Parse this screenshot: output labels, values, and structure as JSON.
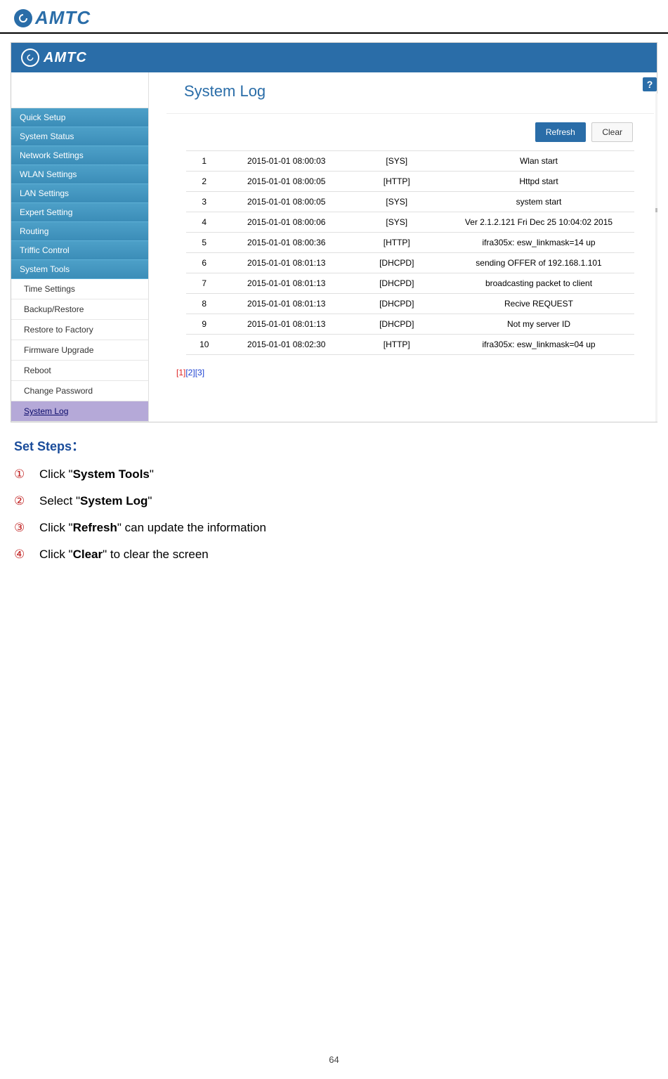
{
  "doc_logo_text": "AMTC",
  "app_logo_text": "AMTC",
  "page_title": "System Log",
  "help_label": "?",
  "buttons": {
    "refresh": "Refresh",
    "clear": "Clear"
  },
  "sidebar": {
    "main": [
      "Quick Setup",
      "System Status",
      "Network Settings",
      "WLAN Settings",
      "LAN Settings",
      "Expert Setting",
      "Routing",
      "Triffic Control",
      "System Tools"
    ],
    "sub": [
      "Time Settings",
      "Backup/Restore",
      "Restore to Factory",
      "Firmware Upgrade",
      "Reboot",
      "Change Password",
      "System Log"
    ],
    "active_sub_index": 6
  },
  "log_rows": [
    {
      "idx": "1",
      "ts": "2015-01-01 08:00:03",
      "mod": "[SYS]",
      "msg": "Wlan start"
    },
    {
      "idx": "2",
      "ts": "2015-01-01 08:00:05",
      "mod": "[HTTP]",
      "msg": "Httpd start"
    },
    {
      "idx": "3",
      "ts": "2015-01-01 08:00:05",
      "mod": "[SYS]",
      "msg": "system start"
    },
    {
      "idx": "4",
      "ts": "2015-01-01 08:00:06",
      "mod": "[SYS]",
      "msg": "Ver 2.1.2.121 Fri Dec 25 10:04:02 2015"
    },
    {
      "idx": "5",
      "ts": "2015-01-01 08:00:36",
      "mod": "[HTTP]",
      "msg": "ifra305x: esw_linkmask=14 up"
    },
    {
      "idx": "6",
      "ts": "2015-01-01 08:01:13",
      "mod": "[DHCPD]",
      "msg": "sending OFFER of 192.168.1.101"
    },
    {
      "idx": "7",
      "ts": "2015-01-01 08:01:13",
      "mod": "[DHCPD]",
      "msg": "broadcasting packet to client"
    },
    {
      "idx": "8",
      "ts": "2015-01-01 08:01:13",
      "mod": "[DHCPD]",
      "msg": "Recive REQUEST"
    },
    {
      "idx": "9",
      "ts": "2015-01-01 08:01:13",
      "mod": "[DHCPD]",
      "msg": "Not my server ID"
    },
    {
      "idx": "10",
      "ts": "2015-01-01 08:02:30",
      "mod": "[HTTP]",
      "msg": "ifra305x: esw_linkmask=04 up"
    }
  ],
  "pagination": {
    "pages": [
      "1",
      "2",
      "3"
    ],
    "current": 0
  },
  "instructions": {
    "header": "Set Steps：",
    "steps": [
      {
        "num": "①",
        "pre": "Click \"",
        "bold": "System Tools",
        "post": "\""
      },
      {
        "num": "②",
        "pre": "Select \"",
        "bold": "System Log",
        "post": "\""
      },
      {
        "num": "③",
        "pre": "Click \"",
        "bold": "Refresh",
        "post": "\" can update the information"
      },
      {
        "num": "④",
        "pre": "Click \"",
        "bold": "Clear",
        "post": "\" to clear the screen"
      }
    ]
  },
  "page_number": "64"
}
